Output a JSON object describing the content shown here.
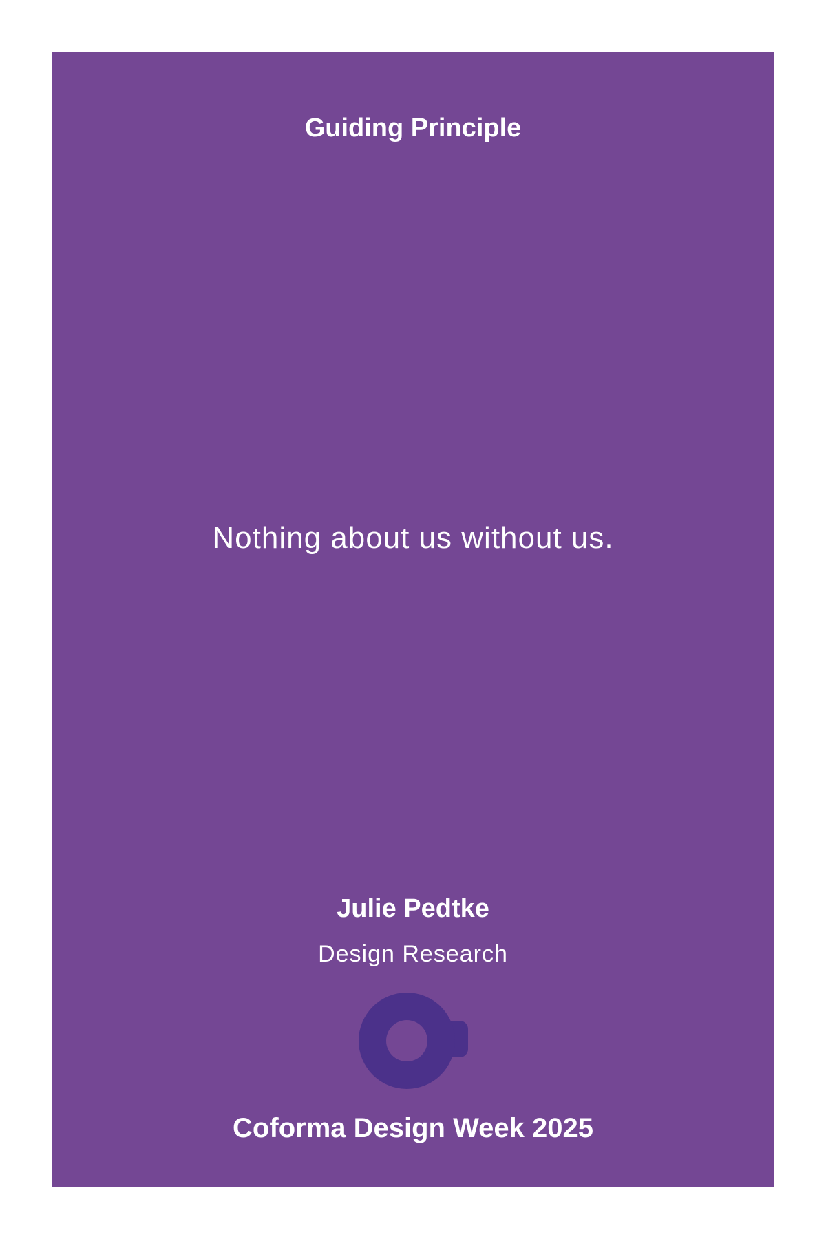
{
  "card": {
    "heading": "Guiding Principle",
    "quote": "Nothing about us without us.",
    "author": {
      "name": "Julie Pedtke",
      "role": "Design Research"
    },
    "logo_icon": "mug-icon",
    "footer": "Coforma Design Week 2025"
  },
  "colors": {
    "card_background": "#744794",
    "text": "#ffffff",
    "logo": "#4b318a"
  }
}
